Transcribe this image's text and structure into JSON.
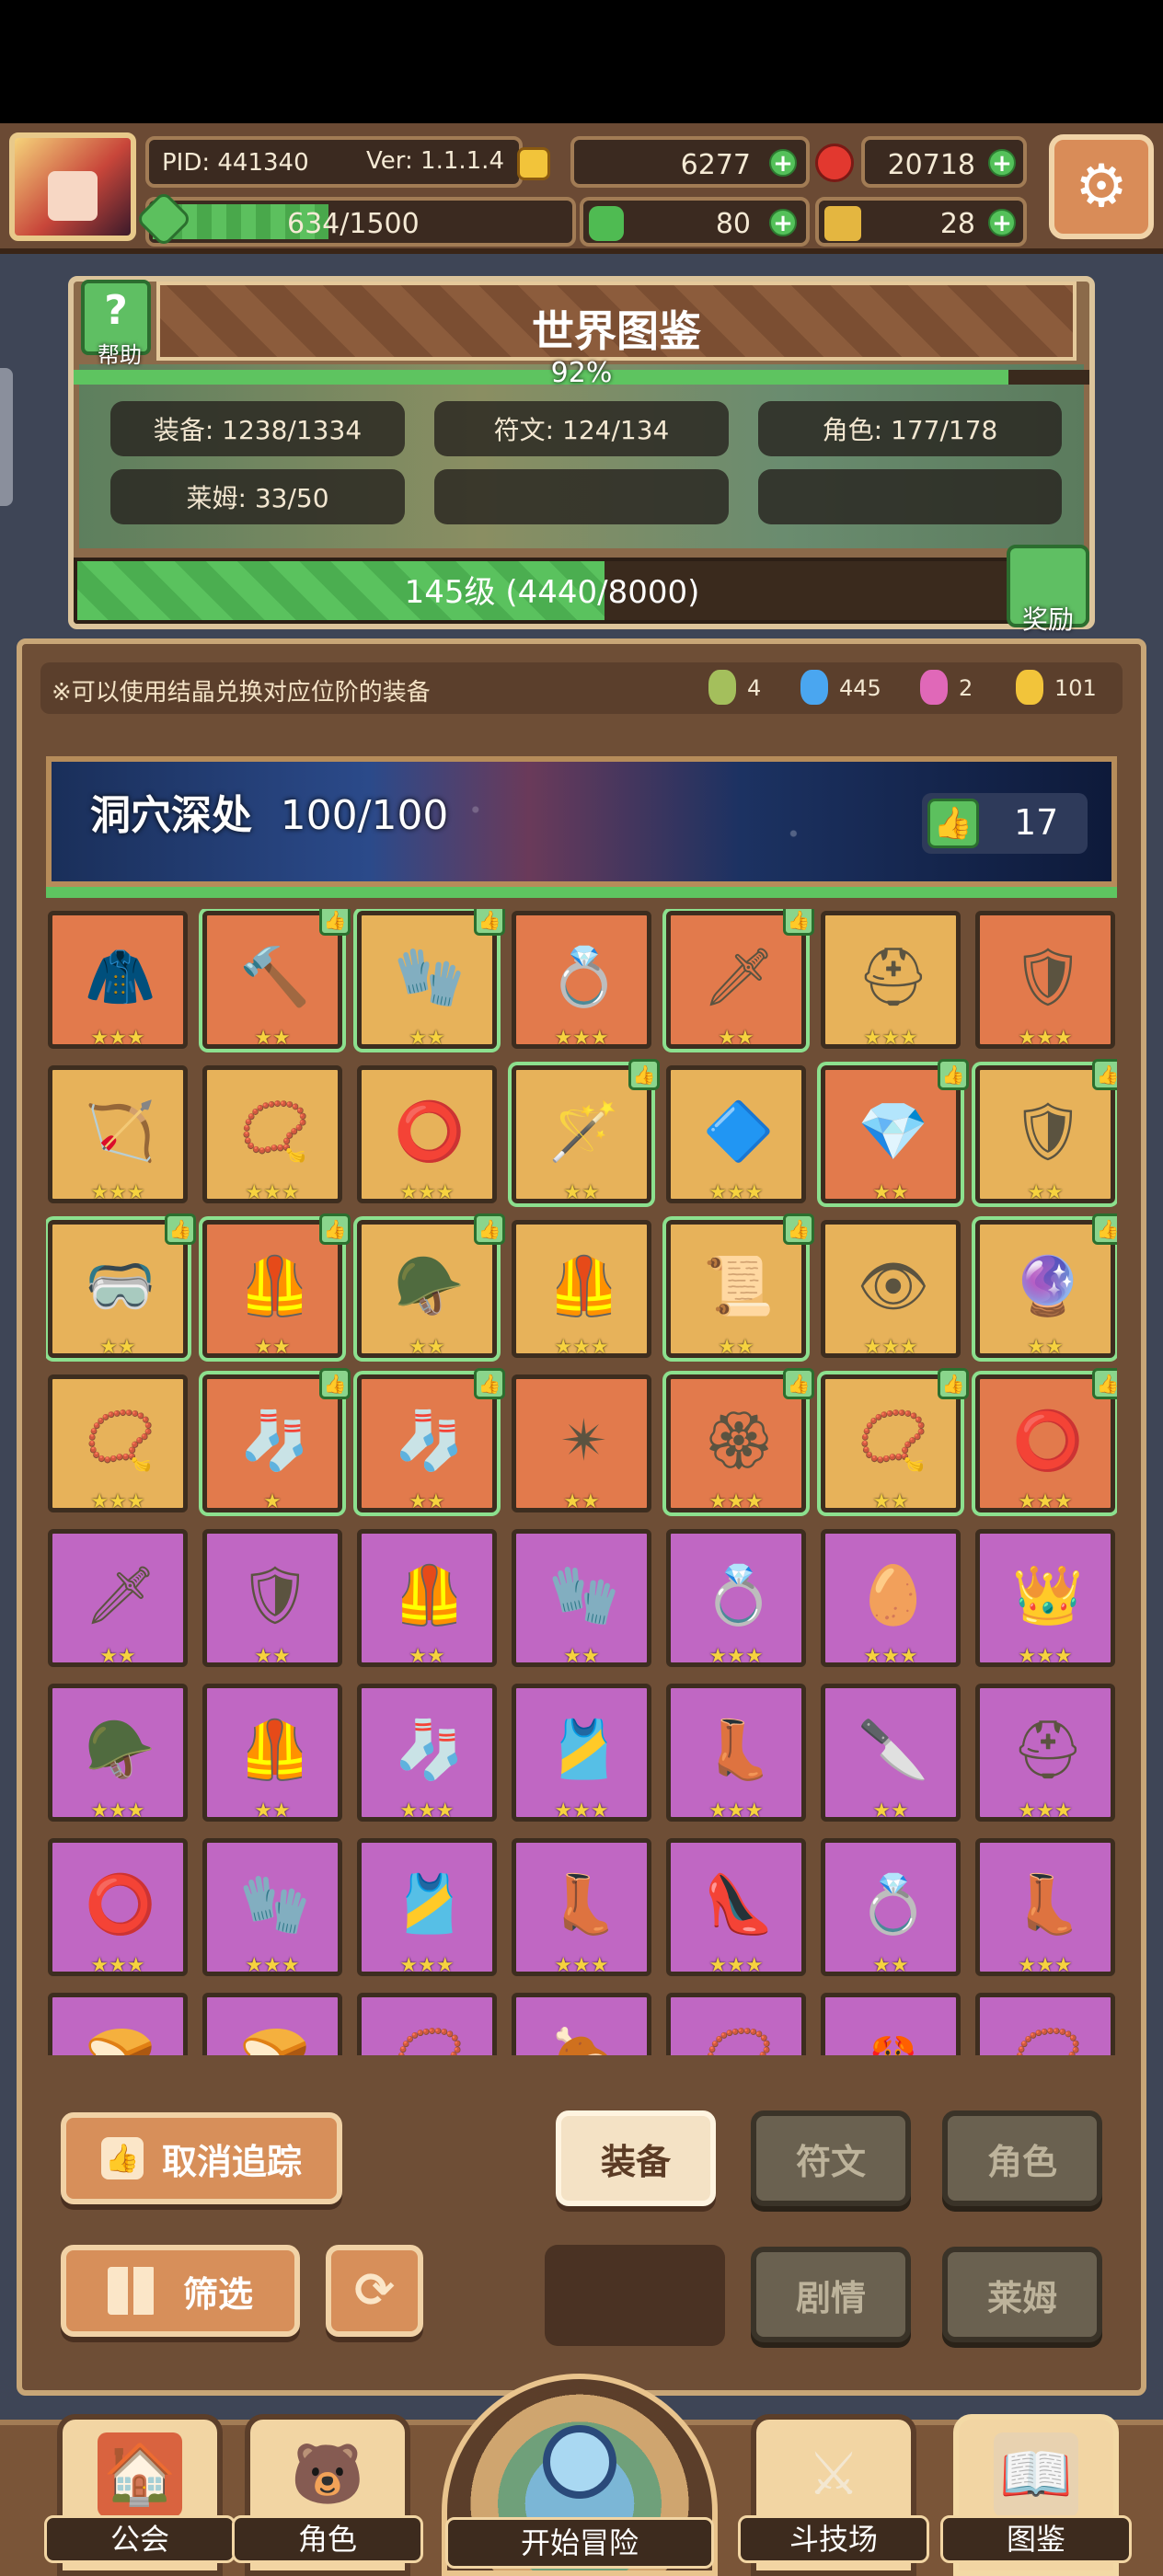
{
  "topbar": {
    "pid": "PID: 441340",
    "ver": "Ver: 1.1.1.4",
    "coins": "6277",
    "rubies": "20718",
    "exp_text": "634/1500",
    "exp_progress": 0.4227,
    "clover": "80",
    "keys": "28"
  },
  "collection": {
    "title": "世界图鉴",
    "percent": "92%",
    "percent_value": 0.92,
    "help_label": "帮助",
    "reward_label": "奖励",
    "stats": [
      "装备: 1238/1334",
      "符文: 124/134",
      "角色: 177/178",
      "莱姆: 33/50"
    ],
    "level_text": "145级 (4440/8000)",
    "level_progress": 0.555
  },
  "notice": {
    "text": "※可以使用结晶兑换对应位阶的装备",
    "gems": [
      {
        "color": "#a4bf5c",
        "count": "4"
      },
      {
        "color": "#4aa6f0",
        "count": "445"
      },
      {
        "color": "#e068b8",
        "count": "2"
      },
      {
        "color": "#f2c43a",
        "count": "101"
      }
    ]
  },
  "region": {
    "name": "洞穴深处",
    "progress": "100/100",
    "likes": "17"
  },
  "items": [
    {
      "c": "orange",
      "i": "🧥",
      "s": "★★★",
      "t": false
    },
    {
      "c": "orange",
      "i": "🔨",
      "s": "★★",
      "t": true
    },
    {
      "c": "gold",
      "i": "🧤",
      "s": "★★",
      "t": true
    },
    {
      "c": "orange",
      "i": "💍",
      "s": "★★★",
      "t": false
    },
    {
      "c": "orange",
      "i": "🗡",
      "s": "★★",
      "t": true
    },
    {
      "c": "gold",
      "i": "⛑",
      "s": "★★★",
      "t": false
    },
    {
      "c": "orange",
      "i": "🛡",
      "s": "★★★",
      "t": false
    },
    {
      "c": "gold",
      "i": "🏹",
      "s": "★★★",
      "t": false
    },
    {
      "c": "gold",
      "i": "📿",
      "s": "★★★",
      "t": false
    },
    {
      "c": "gold",
      "i": "⭕",
      "s": "★★★",
      "t": false
    },
    {
      "c": "gold",
      "i": "🪄",
      "s": "★★",
      "t": true
    },
    {
      "c": "gold",
      "i": "🔷",
      "s": "★★★",
      "t": false
    },
    {
      "c": "orange",
      "i": "💎",
      "s": "★★",
      "t": true
    },
    {
      "c": "gold",
      "i": "🛡",
      "s": "★★",
      "t": true
    },
    {
      "c": "gold",
      "i": "🥽",
      "s": "★★",
      "t": true
    },
    {
      "c": "orange",
      "i": "🦺",
      "s": "★★",
      "t": true
    },
    {
      "c": "gold",
      "i": "🪖",
      "s": "★★",
      "t": true
    },
    {
      "c": "gold",
      "i": "🦺",
      "s": "★★★",
      "t": false
    },
    {
      "c": "gold",
      "i": "📜",
      "s": "★★",
      "t": true
    },
    {
      "c": "gold",
      "i": "👁",
      "s": "★★★",
      "t": false
    },
    {
      "c": "gold",
      "i": "🔮",
      "s": "★★",
      "t": true
    },
    {
      "c": "gold",
      "i": "📿",
      "s": "★★★",
      "t": false
    },
    {
      "c": "orange",
      "i": "🧦",
      "s": "★",
      "t": true
    },
    {
      "c": "orange",
      "i": "🧦",
      "s": "★★",
      "t": true
    },
    {
      "c": "orange",
      "i": "✴",
      "s": "★★",
      "t": false
    },
    {
      "c": "orange",
      "i": "🏵",
      "s": "★★★",
      "t": true
    },
    {
      "c": "gold",
      "i": "📿",
      "s": "★★",
      "t": true
    },
    {
      "c": "orange",
      "i": "⭕",
      "s": "★★★",
      "t": true
    },
    {
      "c": "purple",
      "i": "🗡",
      "s": "★★",
      "t": false
    },
    {
      "c": "purple",
      "i": "🛡",
      "s": "★★",
      "t": false
    },
    {
      "c": "purple",
      "i": "🦺",
      "s": "★★",
      "t": false
    },
    {
      "c": "purple",
      "i": "🧤",
      "s": "★★",
      "t": false
    },
    {
      "c": "purple",
      "i": "💍",
      "s": "★★★",
      "t": false
    },
    {
      "c": "purple",
      "i": "🥚",
      "s": "★★★",
      "t": false
    },
    {
      "c": "purple",
      "i": "👑",
      "s": "★★★",
      "t": false
    },
    {
      "c": "purple",
      "i": "🪖",
      "s": "★★★",
      "t": false
    },
    {
      "c": "purple",
      "i": "🦺",
      "s": "★★",
      "t": false
    },
    {
      "c": "purple",
      "i": "🧦",
      "s": "★★★",
      "t": false
    },
    {
      "c": "purple",
      "i": "🎽",
      "s": "★★★",
      "t": false
    },
    {
      "c": "purple",
      "i": "👢",
      "s": "★★★",
      "t": false
    },
    {
      "c": "purple",
      "i": "🔪",
      "s": "★★",
      "t": false
    },
    {
      "c": "purple",
      "i": "⛑",
      "s": "★★★",
      "t": false
    },
    {
      "c": "purple",
      "i": "⭕",
      "s": "★★★",
      "t": false
    },
    {
      "c": "purple",
      "i": "🧤",
      "s": "★★★",
      "t": false
    },
    {
      "c": "purple",
      "i": "🎽",
      "s": "★★★",
      "t": false
    },
    {
      "c": "purple",
      "i": "👢",
      "s": "★★★",
      "t": false
    },
    {
      "c": "purple",
      "i": "👠",
      "s": "★★★",
      "t": false
    },
    {
      "c": "purple",
      "i": "💍",
      "s": "★★",
      "t": false
    },
    {
      "c": "purple",
      "i": "👢",
      "s": "★★★",
      "t": false
    },
    {
      "c": "purple",
      "i": "🍞",
      "s": "",
      "t": false
    },
    {
      "c": "purple",
      "i": "🍞",
      "s": "",
      "t": false
    },
    {
      "c": "purple",
      "i": "📿",
      "s": "",
      "t": false
    },
    {
      "c": "purple",
      "i": "🍖",
      "s": "",
      "t": false
    },
    {
      "c": "purple",
      "i": "📿",
      "s": "",
      "t": false
    },
    {
      "c": "purple",
      "i": "🦀",
      "s": "",
      "t": false
    },
    {
      "c": "purple",
      "i": "📿",
      "s": "",
      "t": false
    }
  ],
  "buttons": {
    "untrack": "取消追踪",
    "filter": "筛选",
    "equip": "装备",
    "rune": "符文",
    "character": "角色",
    "story": "剧情",
    "slime": "莱姆"
  },
  "nav": {
    "guild": "公会",
    "character": "角色",
    "adventure": "开始冒险",
    "arena": "斗技场",
    "codex": "图鉴"
  }
}
